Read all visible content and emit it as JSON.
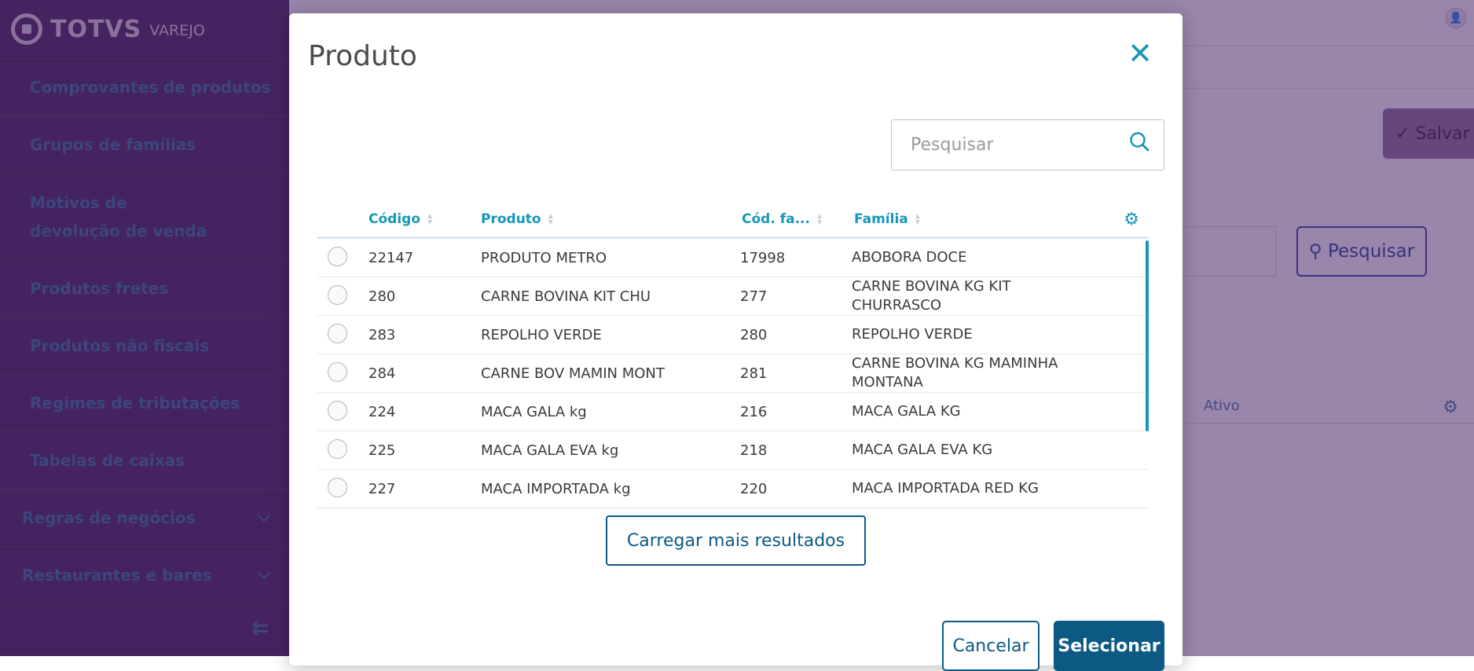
{
  "app": {
    "brand": "TOTVS",
    "brand_sub": "VAREJO"
  },
  "sidebar": {
    "items": [
      {
        "label": "Comprovantes de produtos"
      },
      {
        "label": "Grupos de famílias"
      },
      {
        "label": "Motivos de devolução de venda"
      },
      {
        "label": "Produtos fretes"
      },
      {
        "label": "Produtos não fiscais"
      },
      {
        "label": "Regimes de tributações"
      },
      {
        "label": "Tabelas de caixas"
      }
    ],
    "groups": [
      {
        "label": "Regras de negócios"
      },
      {
        "label": "Restaurantes e bares"
      }
    ]
  },
  "background": {
    "save_label": "Salvar",
    "search_label": "Pesquisar",
    "column_ativo": "Ativo"
  },
  "modal": {
    "title": "Produto",
    "search_placeholder": "Pesquisar",
    "columns": [
      "Código",
      "Produto",
      "Cód. fa...",
      "Família"
    ],
    "rows": [
      {
        "codigo": "22147",
        "produto": "PRODUTO METRO",
        "cod_familia": "17998",
        "familia": "ABOBORA DOCE"
      },
      {
        "codigo": "280",
        "produto": "CARNE BOVINA KIT CHU",
        "cod_familia": "277",
        "familia": "CARNE BOVINA KG KIT CHURRASCO"
      },
      {
        "codigo": "283",
        "produto": "REPOLHO VERDE",
        "cod_familia": "280",
        "familia": "REPOLHO VERDE"
      },
      {
        "codigo": "284",
        "produto": "CARNE BOV MAMIN MONT",
        "cod_familia": "281",
        "familia": "CARNE BOVINA KG MAMINHA MONTANA"
      },
      {
        "codigo": "224",
        "produto": "MACA GALA kg",
        "cod_familia": "216",
        "familia": "MACA GALA KG"
      },
      {
        "codigo": "225",
        "produto": "MACA GALA EVA kg",
        "cod_familia": "218",
        "familia": "MACA GALA EVA KG"
      },
      {
        "codigo": "227",
        "produto": "MACA IMPORTADA kg",
        "cod_familia": "220",
        "familia": "MACA IMPORTADA RED KG"
      }
    ],
    "load_more_label": "Carregar mais resultados",
    "cancel_label": "Cancelar",
    "select_label": "Selecionar"
  },
  "colors": {
    "sidebar_bg": "#3c1f54",
    "accent": "#1797b8",
    "primary": "#0c5a84"
  }
}
